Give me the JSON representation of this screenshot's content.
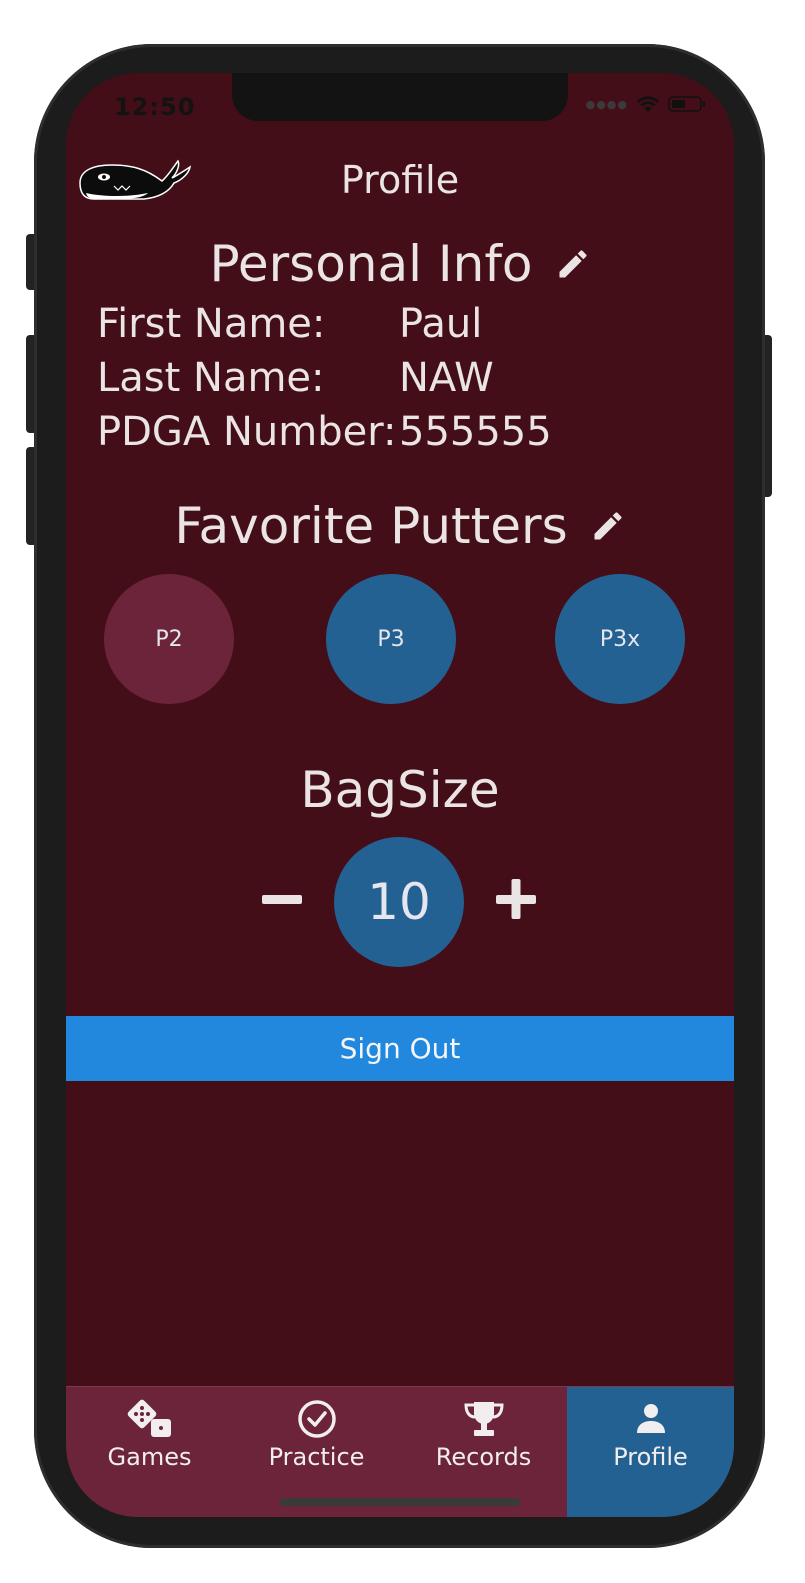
{
  "status_bar": {
    "time": "12:50"
  },
  "header": {
    "title": "Profile"
  },
  "personal_info": {
    "heading": "Personal Info",
    "rows": [
      {
        "label": "First Name:",
        "value": "Paul"
      },
      {
        "label": "Last Name:",
        "value": "NAW"
      },
      {
        "label": "PDGA Number:",
        "value": "555555"
      }
    ]
  },
  "favorite_putters": {
    "heading": "Favorite Putters",
    "items": [
      {
        "label": "P2",
        "selected": false
      },
      {
        "label": "P3",
        "selected": true
      },
      {
        "label": "P3x",
        "selected": true
      }
    ]
  },
  "bag_size": {
    "heading": "BagSize",
    "value": "10"
  },
  "sign_out": {
    "label": "Sign Out"
  },
  "tabs": [
    {
      "label": "Games",
      "icon": "dice-icon",
      "active": false
    },
    {
      "label": "Practice",
      "icon": "check-circle-icon",
      "active": false
    },
    {
      "label": "Records",
      "icon": "trophy-icon",
      "active": false
    },
    {
      "label": "Profile",
      "icon": "person-icon",
      "active": true
    }
  ],
  "colors": {
    "background": "#440e18",
    "tab_inactive": "#6b2439",
    "accent_blue": "#236193",
    "sign_out_blue": "#2188de"
  }
}
